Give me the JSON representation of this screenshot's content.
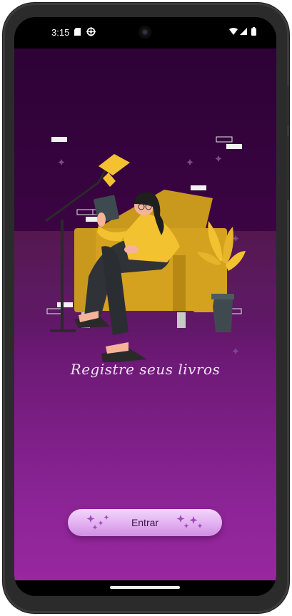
{
  "status_bar": {
    "time": "3:15",
    "left_icons": [
      "sd-card-icon",
      "vpn-settings-icon"
    ],
    "right_icons": [
      "wifi-icon",
      "cellular-signal-icon",
      "battery-icon"
    ]
  },
  "app": {
    "illustration": "woman-reading-in-armchair-illustration",
    "tagline": "Registre seus livros",
    "enter_button": {
      "label": "Entrar"
    }
  },
  "colors": {
    "background_top": "#2b0033",
    "background_bottom": "#99279f",
    "button": "#e1acf0",
    "armchair": "#d4a21f",
    "lamp": "#f2c230"
  }
}
